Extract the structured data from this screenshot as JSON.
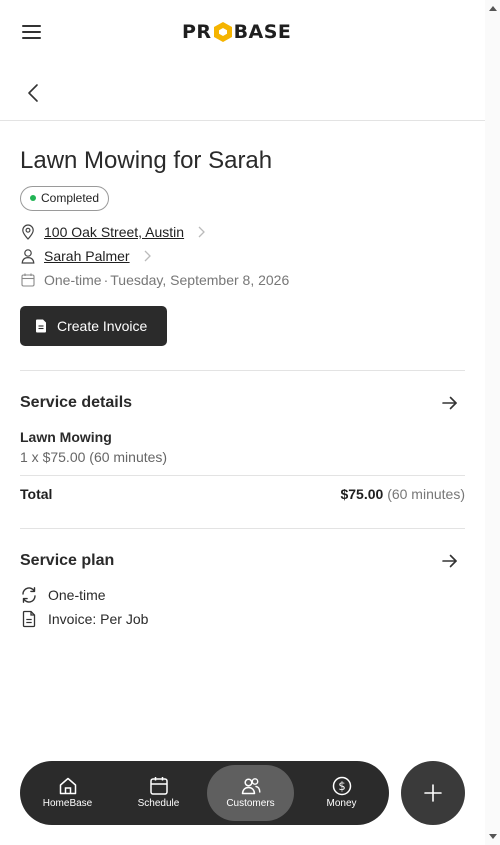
{
  "header": {
    "logo_text": "PROBASE",
    "logo_left": "PR",
    "logo_right": "BASE",
    "accent_color": "#f5b400"
  },
  "job": {
    "title": "Lawn Mowing for Sarah",
    "status": "Completed",
    "status_color": "#22b455",
    "address": "100 Oak Street, Austin",
    "customer": "Sarah Palmer",
    "frequency": "One-time",
    "separator": "·",
    "date": "Tuesday, September 8, 2026",
    "create_invoice_label": "Create Invoice"
  },
  "service_details": {
    "heading": "Service details",
    "service_name": "Lawn Mowing",
    "service_line": "1 x $75.00 (60 minutes)",
    "total_label": "Total",
    "total_amount": "$75.00",
    "total_duration": "(60 minutes)"
  },
  "service_plan": {
    "heading": "Service plan",
    "frequency": "One-time",
    "invoice": "Invoice: Per Job"
  },
  "bottom_nav": {
    "items": [
      {
        "label": "HomeBase",
        "icon": "home-icon"
      },
      {
        "label": "Schedule",
        "icon": "calendar-icon"
      },
      {
        "label": "Customers",
        "icon": "users-icon",
        "active": true
      },
      {
        "label": "Money",
        "icon": "dollar-icon"
      }
    ],
    "fab_icon": "plus-icon"
  }
}
